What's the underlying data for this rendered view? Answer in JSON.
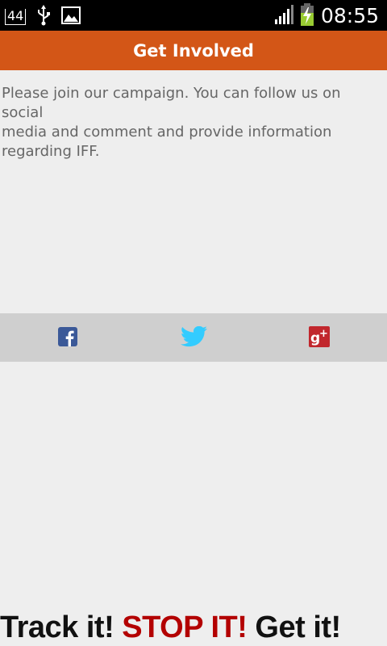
{
  "status_bar": {
    "notification_count": "44",
    "time": "08:55",
    "icons": [
      "notification-44-icon",
      "usb-icon",
      "image-icon",
      "signal-icon",
      "battery-charging-icon"
    ]
  },
  "header": {
    "title": "Get Involved"
  },
  "intro": {
    "line1": "Please join our campaign. You can follow us on social",
    "line2": "media and comment and provide information",
    "line3": "regarding IFF."
  },
  "social": {
    "icons": [
      "facebook-icon",
      "twitter-icon",
      "google-plus-icon"
    ],
    "colors": {
      "facebook": "#3b5998",
      "twitter": "#33ccff",
      "google_plus": "#c1272d"
    }
  },
  "footer": {
    "part1": "Track it! ",
    "part2": "STOP IT!",
    "part3": " Get it!"
  },
  "colors": {
    "header_bg": "#d35617",
    "page_bg": "#eeeeee",
    "social_bar_bg": "#cfcfcf",
    "footer_red": "#b30000"
  }
}
